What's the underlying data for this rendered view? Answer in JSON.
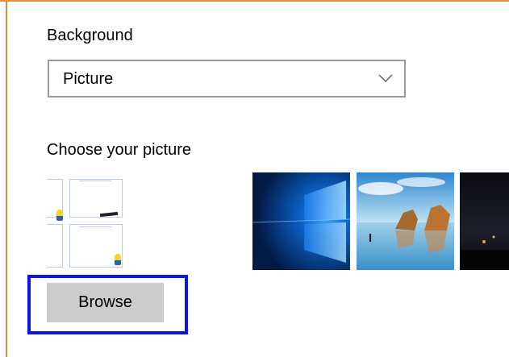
{
  "background": {
    "label": "Background",
    "selected_value": "Picture"
  },
  "picture": {
    "label": "Choose your picture",
    "thumbnails": [
      {
        "name": "custom-collage"
      },
      {
        "name": "windows-10-default"
      },
      {
        "name": "beach-rocks"
      },
      {
        "name": "night-sky"
      }
    ],
    "browse_label": "Browse"
  },
  "colors": {
    "frame_accent": "#e8893b",
    "highlight_box": "#0a14e6",
    "button_bg": "#cccccc"
  }
}
